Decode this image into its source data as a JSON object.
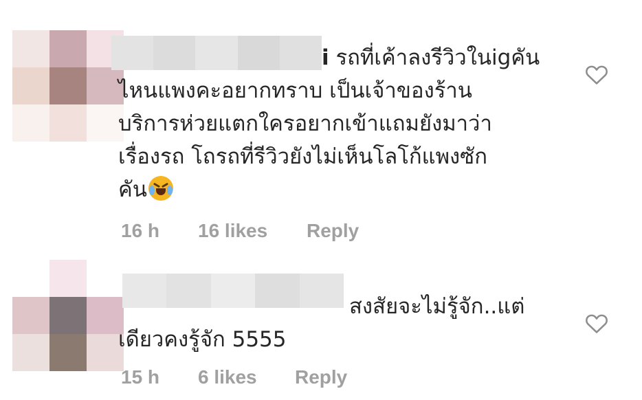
{
  "comments": [
    {
      "username_tail": "i",
      "text_lines": [
        "รถที่เค้าลงรีวิวในigคัน",
        "ไหนแพงคะอยากทราบ เป็นเจ้าของร้าน",
        "บริการห่วยแตกใครอยากเข้าแถมยังมาว่า",
        "เรื่องรถ โถรถที่รีวิวยังไม่เห็นโลโก้แพงซัก",
        "คัน"
      ],
      "time": "16 h",
      "likes": "16 likes",
      "reply": "Reply",
      "avatar_colors": [
        "#f1e6e3",
        "#caa8b0",
        "#f3e1e5",
        "#ead6cd",
        "#a7847f",
        "#d6b9be",
        "#f8f1ee",
        "#f1e0db",
        "#fbf6f4"
      ],
      "name_blur_colors": [
        "#e3e3e3",
        "#dcdcdc",
        "#e6e6e6",
        "#d9d9d9",
        "#e0e0e0"
      ]
    },
    {
      "username_tail": "",
      "text_lines": [
        "สงสัยจะไม่รู้จัก..แต่",
        "เดียวคงรู้จัก 5555"
      ],
      "time": "15 h",
      "likes": "6 likes",
      "reply": "Reply",
      "avatar_colors": [
        "#ffffff",
        "#f6e6ec",
        "#ffffff",
        "#dfc5c7",
        "#7d7276",
        "#dcbcc7",
        "#ebe0dd",
        "#8a7a70",
        "#eadad9"
      ],
      "name_blur_colors": [
        "#e8e8e8",
        "#e2e2e2",
        "#ececec",
        "#dedede",
        "#e5e5e5"
      ]
    }
  ],
  "icons": {
    "like": "heart-outline-icon",
    "emoji": "rolling-on-floor-laughing-emoji"
  },
  "colors": {
    "text": "#262626",
    "meta": "#a0a0a0",
    "heart_stroke": "#8e8e8e"
  }
}
